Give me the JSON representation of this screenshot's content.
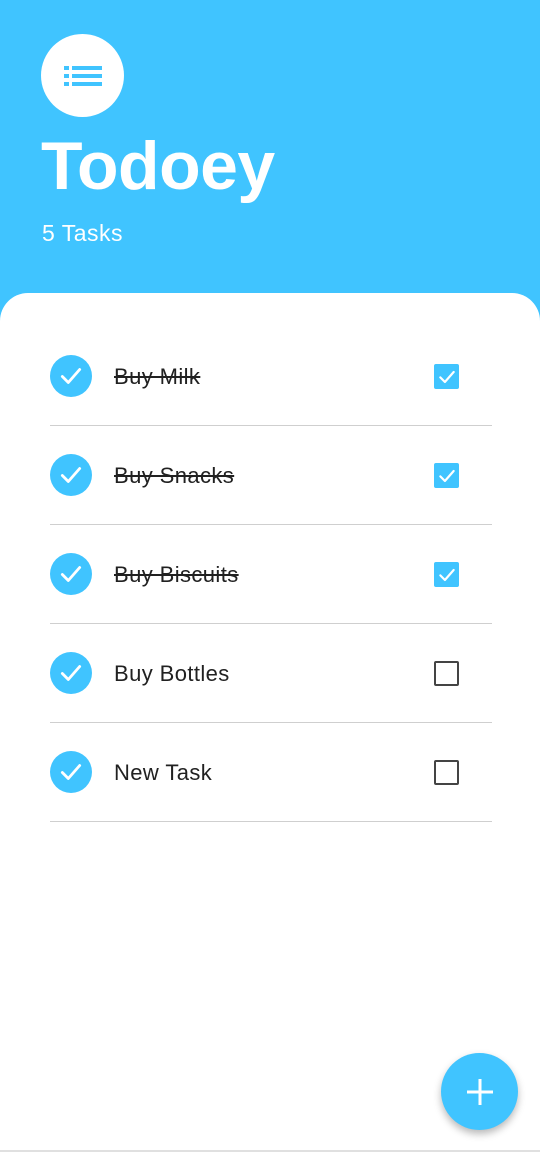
{
  "header": {
    "logo_icon": "list-icon",
    "title": "Todoey",
    "task_count": "5 Tasks"
  },
  "colors": {
    "accent": "#40c4ff",
    "sheet": "#ffffff",
    "text": "#212121"
  },
  "tasks": [
    {
      "title": "Buy Milk",
      "done": true
    },
    {
      "title": "Buy Snacks",
      "done": true
    },
    {
      "title": "Buy Biscuits",
      "done": true
    },
    {
      "title": "Buy Bottles",
      "done": false
    },
    {
      "title": "New Task",
      "done": false
    }
  ],
  "fab": {
    "icon": "plus-icon"
  }
}
